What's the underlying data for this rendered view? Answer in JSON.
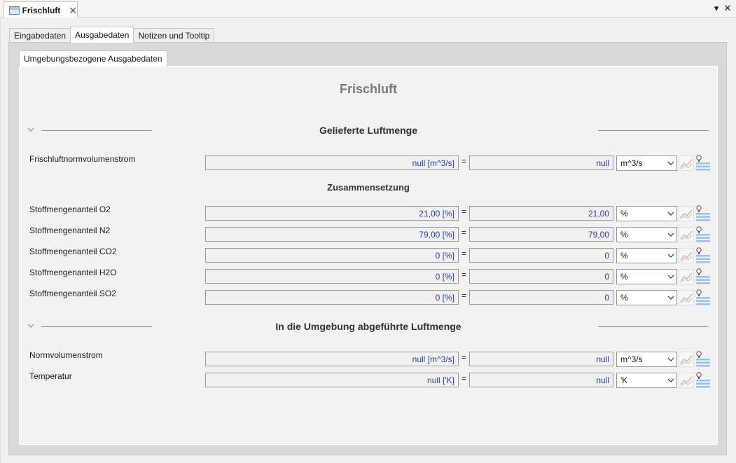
{
  "editor": {
    "tab_title": "Frischluft",
    "tab_icon": "window-icon",
    "close_icon": "close-icon",
    "menu_icon": "dropdown-menu-icon"
  },
  "tabs": [
    {
      "label": "Eingabedaten",
      "active": false
    },
    {
      "label": "Ausgabedaten",
      "active": true
    },
    {
      "label": "Notizen und Tooltip",
      "active": false
    }
  ],
  "subtab": {
    "label": "Umgebungsbezogene Ausgabedaten"
  },
  "page": {
    "title": "Frischluft"
  },
  "section1": {
    "title": "Gelieferte Luftmenge",
    "rows": [
      {
        "label": "Frischluftnormvolumenstrom",
        "value": "null [m^3/s]",
        "converted": "null",
        "unit": "m^3/s"
      }
    ],
    "sub_title": "Zusammensetzung",
    "composition": [
      {
        "label": "Stoffmengenanteil O2",
        "value": "21,00 [%]",
        "converted": "21,00",
        "unit": "%"
      },
      {
        "label": "Stoffmengenanteil N2",
        "value": "79,00 [%]",
        "converted": "79,00",
        "unit": "%"
      },
      {
        "label": "Stoffmengenanteil CO2",
        "value": "0 [%]",
        "converted": "0",
        "unit": "%"
      },
      {
        "label": "Stoffmengenanteil H2O",
        "value": "0 [%]",
        "converted": "0",
        "unit": "%"
      },
      {
        "label": "Stoffmengenanteil SO2",
        "value": "0 [%]",
        "converted": "0",
        "unit": "%"
      }
    ]
  },
  "section2": {
    "title": "In die Umgebung abgeführte Luftmenge",
    "rows": [
      {
        "label": "Normvolumenstrom",
        "value": "null [m^3/s]",
        "converted": "null",
        "unit": "m^3/s"
      },
      {
        "label": "Temperatur",
        "value": "null ['K]",
        "converted": "null",
        "unit": "'K"
      }
    ]
  },
  "equals_sign": "=",
  "icons": {
    "graph": "trend-graph-icon",
    "list": "lightbulb-list-icon",
    "collapse": "chevron-down-icon"
  },
  "colors": {
    "value_text": "#2a3f9d",
    "panel_bg": "#f2f2f2",
    "title_gray": "#7a7a7a"
  }
}
